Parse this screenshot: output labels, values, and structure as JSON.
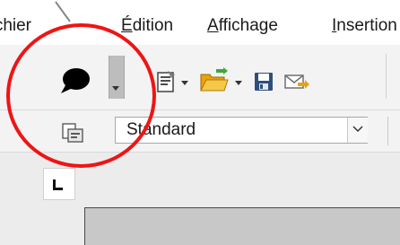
{
  "menu": {
    "items": [
      {
        "label": "Fichier",
        "mnemonic": "F"
      },
      {
        "label": "Édition",
        "mnemonic": "É"
      },
      {
        "label": "Affichage",
        "mnemonic": "A"
      },
      {
        "label": "Insertion",
        "mnemonic": "I"
      }
    ]
  },
  "toolbar": {
    "icons": [
      "comment-icon",
      "templates-icon",
      "open-folder-icon",
      "save-icon",
      "email-icon"
    ]
  },
  "formatting": {
    "icon": "styles-icon",
    "style_value": "Standard"
  },
  "colors": {
    "annotation": "#ee1515",
    "toolbar_bg": "#f3f3f3",
    "menubar_bg": "#ffffff",
    "page_fill": "#c8c8c8"
  }
}
